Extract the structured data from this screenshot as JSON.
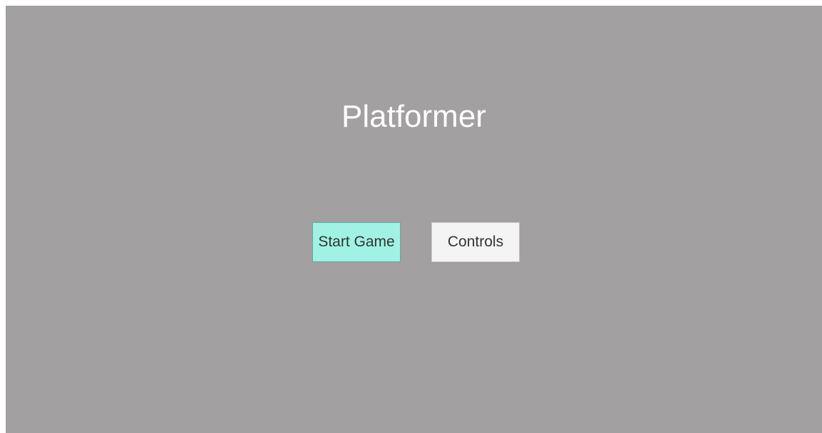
{
  "screen": {
    "background_color": "#a2a0a1"
  },
  "title": {
    "text": "Platformer",
    "color": "#ffffff"
  },
  "menu": {
    "buttons": [
      {
        "label": "Start Game",
        "state": "highlighted",
        "color": "#a0f2e4"
      },
      {
        "label": "Controls",
        "state": "normal",
        "color": "#f4f4f4"
      }
    ]
  }
}
